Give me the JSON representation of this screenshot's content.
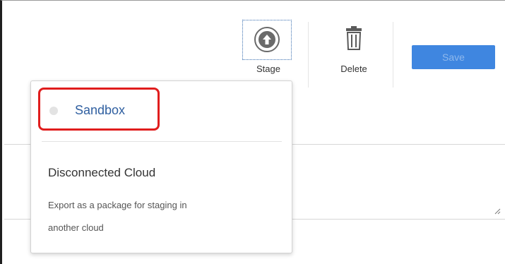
{
  "toolbar": {
    "stage": {
      "label": "Stage",
      "icon": "upload-arrow-circle-icon"
    },
    "delete": {
      "label": "Delete",
      "icon": "trash-icon"
    },
    "save": {
      "label": "Save"
    }
  },
  "stage_menu": {
    "options": [
      {
        "label": "Sandbox",
        "selected": false,
        "highlighted": true
      },
      {
        "label": "Disconnected Cloud",
        "description_line1": "Export as a package for staging in",
        "description_line2": "another cloud"
      }
    ]
  },
  "colors": {
    "save_button_bg": "#3f86e0",
    "sandbox_link": "#2f5fa0",
    "highlight_border": "#e01d1d"
  }
}
